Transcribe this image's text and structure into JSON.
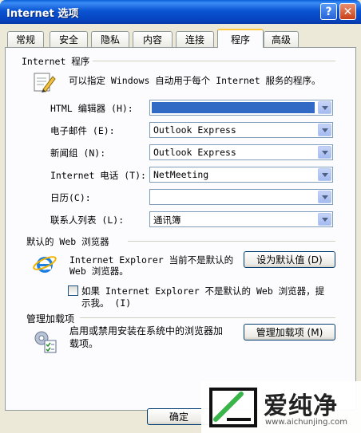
{
  "window": {
    "title": "Internet 选项",
    "help_label": "?",
    "close_label": "✕"
  },
  "tabs": [
    {
      "label": "常规"
    },
    {
      "label": "安全"
    },
    {
      "label": "隐私"
    },
    {
      "label": "内容"
    },
    {
      "label": "连接"
    },
    {
      "label": "程序",
      "active": true
    },
    {
      "label": "高级"
    }
  ],
  "programs": {
    "group_title": "Internet 程序",
    "description": "可以指定 Windows 自动用于每个 Internet 服务的程序。",
    "rows": [
      {
        "label": "HTML 编辑器 (H):",
        "value": ""
      },
      {
        "label": "电子邮件 (E):",
        "value": "Outlook Express"
      },
      {
        "label": "新闻组 (N):",
        "value": "Outlook Express"
      },
      {
        "label": "Internet 电话 (T):",
        "value": "NetMeeting"
      },
      {
        "label": "日历(C):",
        "value": ""
      },
      {
        "label": "联系人列表 (L):",
        "value": "通讯簿"
      }
    ]
  },
  "browser": {
    "group_title": "默认的 Web 浏览器",
    "status_line1": "Internet Explorer 当前不是默认的",
    "status_line2": "Web 浏览器。",
    "set_default_button": "设为默认值 (D)",
    "check_line1": "如果 Internet Explorer 不是默认的 Web 浏览器，提",
    "check_line2": "示我。 (I)"
  },
  "addons": {
    "group_title": "管理加载项",
    "desc_line1": "启用或禁用安装在系统中的浏览器加",
    "desc_line2": "载项。",
    "manage_button": "管理加载项 (M)"
  },
  "footer": {
    "ok_button": "确定"
  },
  "watermark": {
    "brand": "爱纯净",
    "url": "www.aichunjing.com"
  },
  "colors": {
    "titlebar": "#0a54d2",
    "dialog_bg": "#ece9d8",
    "panel_bg": "#fcfcfe",
    "selection": "#316ac5"
  }
}
